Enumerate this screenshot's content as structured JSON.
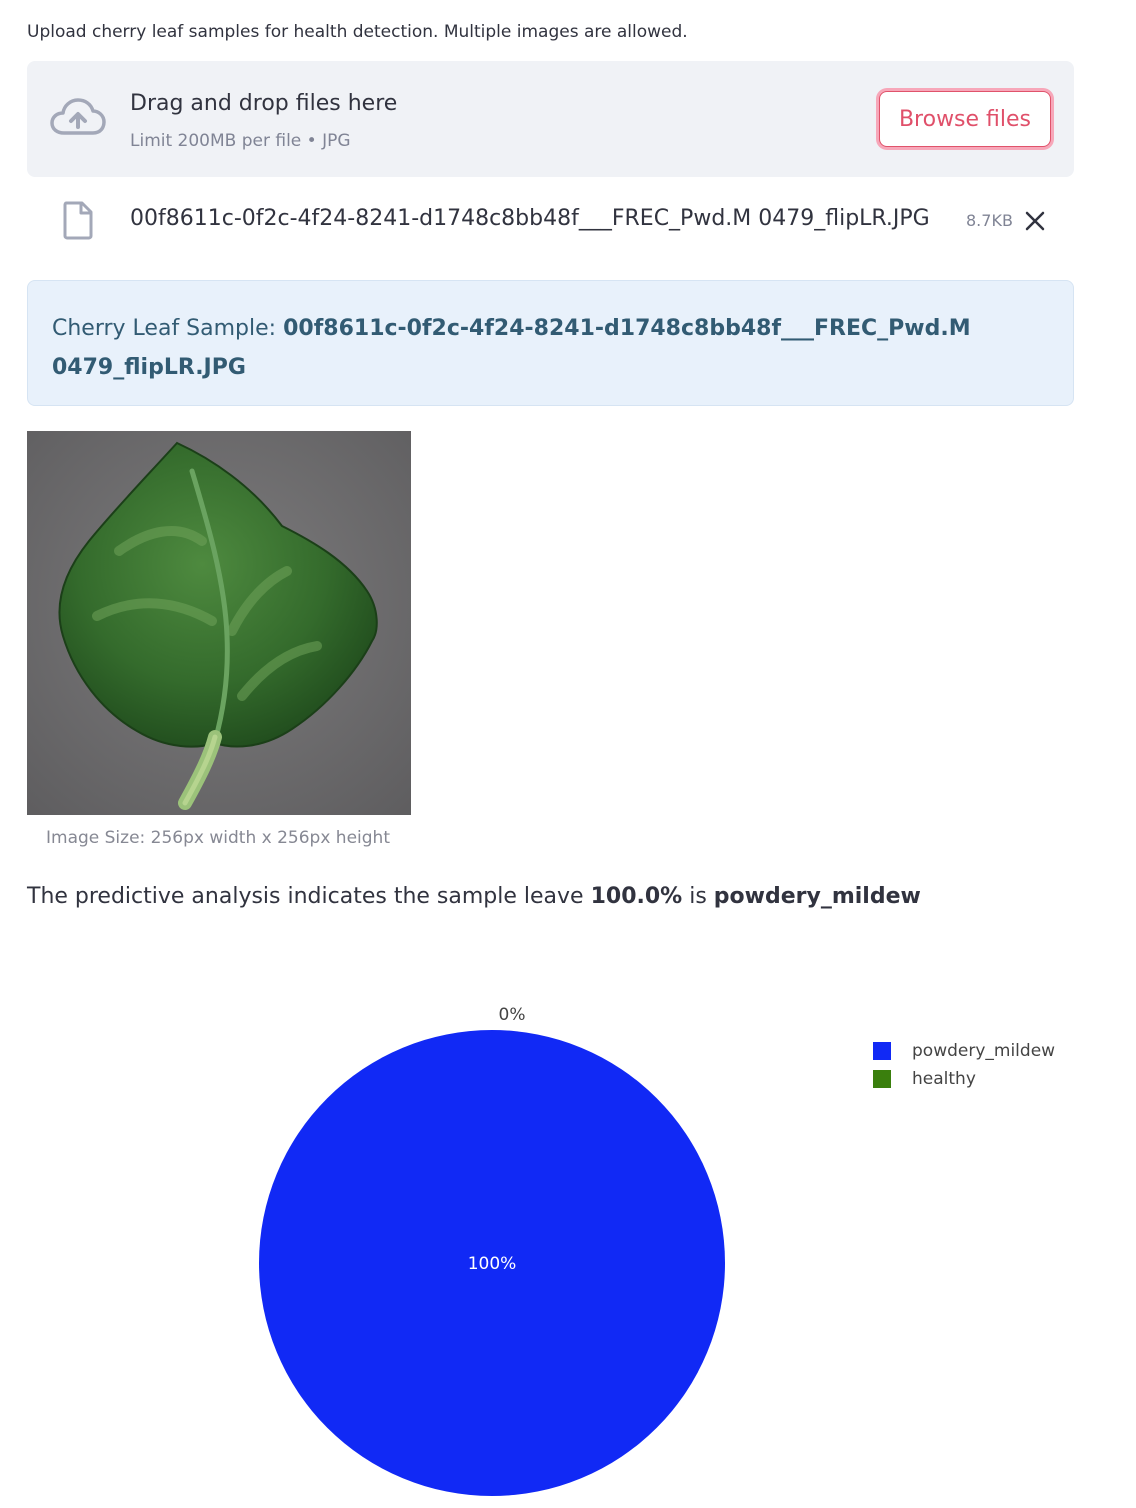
{
  "instruction": "Upload cherry leaf samples for health detection. Multiple images are allowed.",
  "uploader": {
    "title": "Drag and drop files here",
    "limit_text": "Limit 200MB per file • JPG",
    "browse_label": "Browse files"
  },
  "file": {
    "name": "00f8611c-0f2c-4f24-8241-d1748c8bb48f___FREC_Pwd.M 0479_flipLR.JPG",
    "size": "8.7KB"
  },
  "info_box": {
    "prefix": "Cherry Leaf Sample: ",
    "filename": "00f8611c-0f2c-4f24-8241-d1748c8bb48f___FREC_Pwd.M 0479_flipLR.JPG"
  },
  "image_caption": "Image Size: 256px width x 256px height",
  "prediction": {
    "prefix": "The predictive analysis indicates the sample leave ",
    "percent": "100.0%",
    "middle": " is ",
    "label": "powdery_mildew"
  },
  "colors": {
    "accent": "#ff4b4b",
    "info_text": "#325b73",
    "powdery_mildew": "#1129f5",
    "healthy": "#3a7f0d"
  },
  "icons": {
    "upload": "cloud-upload-icon",
    "file": "file-icon",
    "close": "close-icon"
  },
  "chart_data": {
    "type": "pie",
    "title": "",
    "labels": [
      "powdery_mildew",
      "healthy"
    ],
    "values": [
      100,
      0
    ],
    "slice_labels": [
      "100%",
      "0%"
    ],
    "colors": [
      "#1129f5",
      "#3a7f0d"
    ],
    "legend": "top-right"
  }
}
